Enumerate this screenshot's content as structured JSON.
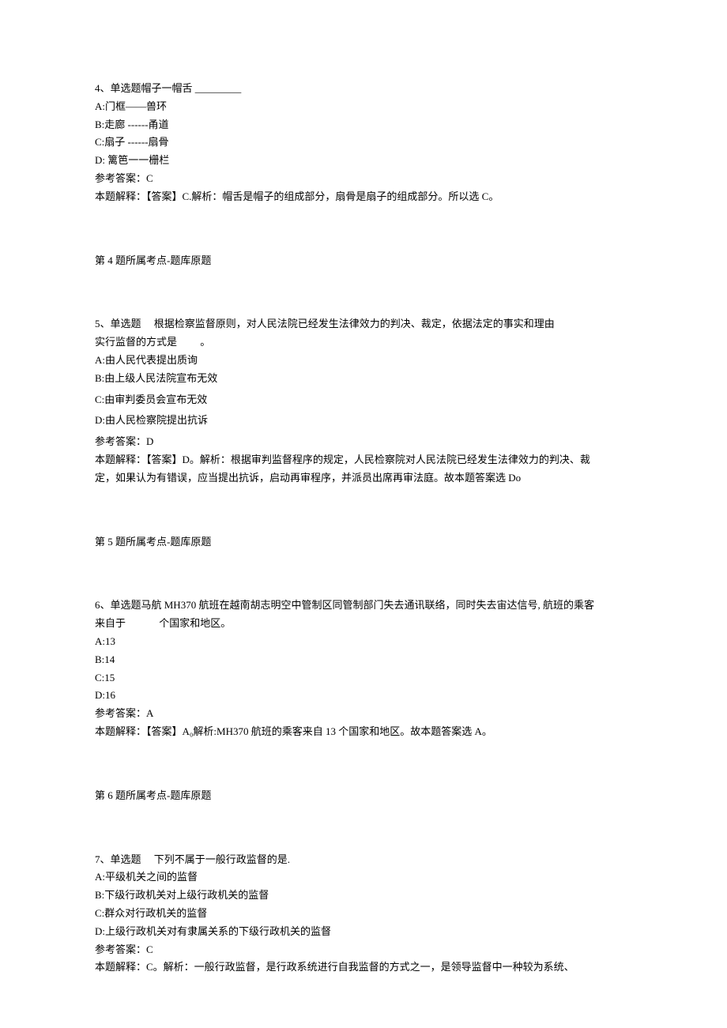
{
  "q4": {
    "stem": "4、单选题帽子一帽舌 _________",
    "optA": "A:门框——兽环",
    "optB": "B:走廊 ------甬道",
    "optC": "C:扇子 ------扇骨",
    "optD": "D: 篱笆一一栅栏",
    "refAns": "参考答案：C",
    "expl": "本题解释：【答案】C.解析：帽舌是帽子的组成部分，扇骨是扇子的组成部分。所以选 C。",
    "source": "第 4 题所属考点-题库原题"
  },
  "q5": {
    "stem1": "5、单选题  根据检察监督原则，对人民法院已经发生法律效力的判决、裁定，依据法定的事实和理由",
    "stem2": "实行监督的方式是   。",
    "optA": "A:由人民代表提出质询",
    "optB": "B:由上级人民法院宣布无效",
    "optC": "C:由审判委员会宣布无效",
    "optD": "D:由人民检察院提出抗诉",
    "refAns": "参考答案：D",
    "expl1": "本题解释：【答案】D。解析：根据审判监督程序的规定，人民检察院对人民法院已经发生法律效力的判决、裁",
    "expl2": "定，如果认为有错误，应当提出抗诉，启动再审程序，并派员出席再审法庭。故本题答案选 Do",
    "source": "第 5 题所属考点-题库原题"
  },
  "q6": {
    "stem1": "6、单选题马航 MH370 航班在越南胡志明空中管制区同管制部门失去通讯联络，同时失去宙达信号, 航班的乘客",
    "stem2": "来自于    个国家和地区。",
    "optA": "A:13",
    "optB": "B:14",
    "optC": "C:15",
    "optD": "D:16",
    "refAns": "参考答案：A",
    "expl": "本题解释：【答案】A₀解析:MH370 航班的乘客来自 13 个国家和地区。故本题答案选 A。",
    "source": "第 6 题所属考点-题库原题"
  },
  "q7": {
    "stem": "7、单选题  下列不属于一般行政监督的是.",
    "optA": "A:平级机关之间的监督",
    "optB": "B:下级行政机关对上级行政机关的监督",
    "optC": "C:群众对行政机关的监督",
    "optD": "D:上级行政机关对有隶属关系的下级行政机关的监督",
    "refAns": "参考答案：C",
    "expl": "本题解释：C。解析：一般行政监督，是行政系统进行自我监督的方式之一，是领导监督中一种较为系统、"
  }
}
